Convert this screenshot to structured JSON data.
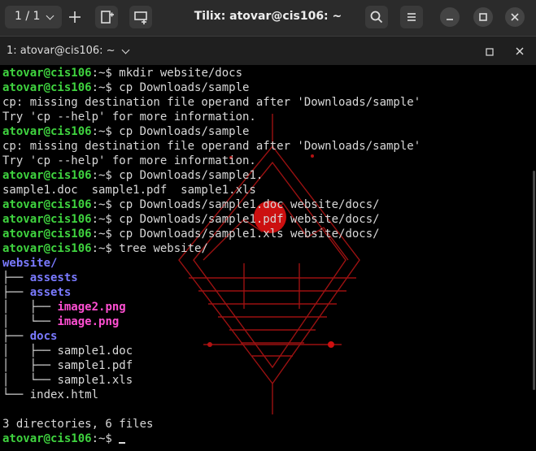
{
  "title_bar": {
    "session_label": "1 / 1",
    "title": "Tilix: atovar@cis106: ~"
  },
  "tab_bar": {
    "label": "1: atovar@cis106: ~"
  },
  "prompt": {
    "user_host": "atovar@cis106",
    "sep": ":~$ "
  },
  "terminal": {
    "cmd1": "mkdir website/docs",
    "cmd2": "cp Downloads/sample",
    "err1": "cp: missing destination file operand after 'Downloads/sample'",
    "hint1": "Try 'cp --help' for more information.",
    "cmd3": "cp Downloads/sample",
    "err2": "cp: missing destination file operand after 'Downloads/sample'",
    "hint2": "Try 'cp --help' for more information.",
    "cmd4": "cp Downloads/sample1.",
    "completion": "sample1.doc  sample1.pdf  sample1.xls",
    "cmd5": "cp Downloads/sample1.doc website/docs/",
    "cmd6": "cp Downloads/sample1.pdf website/docs/",
    "cmd7": "cp Downloads/sample1.xls website/docs/",
    "cmd8": "tree website/",
    "tree": {
      "root": "website/",
      "d1_prefix": "├── ",
      "d1": "assests",
      "d2_prefix": "├── ",
      "d2": "assets",
      "f1_prefix": "│   ├── ",
      "f1": "image2.png",
      "f2_prefix": "│   └── ",
      "f2": "image.png",
      "d3_prefix": "├── ",
      "d3": "docs",
      "f3_prefix": "│   ├── ",
      "f3": "sample1.doc",
      "f4_prefix": "│   ├── ",
      "f4": "sample1.pdf",
      "f5_prefix": "│   └── ",
      "f5": "sample1.xls",
      "f6_prefix": "└── ",
      "f6": "index.html"
    },
    "summary": "3 directories, 6 files"
  },
  "colors": {
    "prompt_green": "#3fd33f",
    "directory_blue": "#7a7aff",
    "image_magenta": "#ff4fd2",
    "wallpaper_red": "#cc1a1a"
  },
  "icons": {
    "new_session": "add-icon",
    "split_right": "split-right-icon",
    "split_down": "split-down-icon",
    "find": "search-icon",
    "menu": "hamburger-menu-icon",
    "minimize": "minimize-icon",
    "maximize": "maximize-icon",
    "close": "close-icon"
  }
}
